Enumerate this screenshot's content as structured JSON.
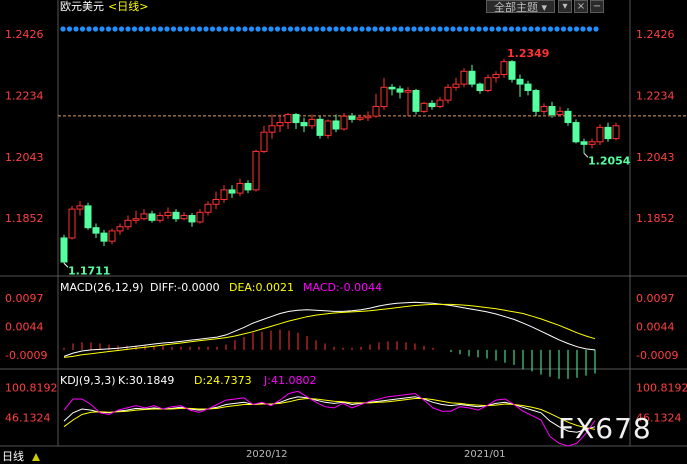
{
  "header": {
    "title_pair": "欧元美元",
    "title_period": "<日线>",
    "theme_button": "全部主题",
    "theme_button_icon": "chevron-down-icon",
    "side_button_icons": [
      "chevron-down-icon",
      "close-icon",
      "minus-icon"
    ]
  },
  "colors": {
    "up": "#ff3232",
    "down": "#54ffa0",
    "price_axis": "#ff4040",
    "macd_label": "#ffffff",
    "dea": "#ffff00",
    "macd": "#ff00ff",
    "j_line": "#ff00ff",
    "dot": "#1e90ff"
  },
  "chart_data": [
    {
      "type": "candlestick",
      "title": "欧元美元<日线>",
      "ylim": [
        1.169,
        1.247
      ],
      "price_ticks": [
        "1.2426",
        "1.2234",
        "1.2043",
        "1.1852"
      ],
      "current_price": 1.2171,
      "annotations": [
        {
          "label": "1.2349",
          "kind": "high"
        },
        {
          "label": "1.2054",
          "kind": "low"
        },
        {
          "label": "1.1711",
          "kind": "low"
        }
      ],
      "candles": [
        [
          1.179,
          1.1715,
          1.18,
          1.1711
        ],
        [
          1.179,
          1.188,
          1.189,
          1.1785
        ],
        [
          1.188,
          1.189,
          1.1905,
          1.186
        ],
        [
          1.189,
          1.1822,
          1.19,
          1.1815
        ],
        [
          1.1822,
          1.1805,
          1.1835,
          1.179
        ],
        [
          1.1805,
          1.178,
          1.1815,
          1.1765
        ],
        [
          1.178,
          1.1812,
          1.182,
          1.177
        ],
        [
          1.1812,
          1.1825,
          1.1835,
          1.18
        ],
        [
          1.1825,
          1.1845,
          1.186,
          1.1815
        ],
        [
          1.1845,
          1.185,
          1.1875,
          1.1835
        ],
        [
          1.185,
          1.1865,
          1.188,
          1.1845
        ],
        [
          1.1865,
          1.1845,
          1.1875,
          1.1838
        ],
        [
          1.1845,
          1.186,
          1.187,
          1.1838
        ],
        [
          1.186,
          1.187,
          1.1885,
          1.185
        ],
        [
          1.187,
          1.185,
          1.188,
          1.184
        ],
        [
          1.185,
          1.186,
          1.187,
          1.1845
        ],
        [
          1.186,
          1.184,
          1.1868,
          1.1825
        ],
        [
          1.184,
          1.187,
          1.188,
          1.1835
        ],
        [
          1.187,
          1.1895,
          1.1905,
          1.186
        ],
        [
          1.1895,
          1.191,
          1.1935,
          1.188
        ],
        [
          1.191,
          1.194,
          1.1955,
          1.19
        ],
        [
          1.194,
          1.193,
          1.1955,
          1.1915
        ],
        [
          1.193,
          1.196,
          1.1975,
          1.192
        ],
        [
          1.196,
          1.194,
          1.197,
          1.193
        ],
        [
          1.194,
          1.206,
          1.2065,
          1.1935
        ],
        [
          1.206,
          1.212,
          1.214,
          1.2055
        ],
        [
          1.212,
          1.214,
          1.2175,
          1.21
        ],
        [
          1.214,
          1.215,
          1.2175,
          1.212
        ],
        [
          1.215,
          1.2175,
          1.218,
          1.213
        ],
        [
          1.2175,
          1.215,
          1.218,
          1.213
        ],
        [
          1.215,
          1.214,
          1.2165,
          1.212
        ],
        [
          1.214,
          1.216,
          1.2175,
          1.213
        ],
        [
          1.216,
          1.211,
          1.217,
          1.21
        ],
        [
          1.211,
          1.2155,
          1.216,
          1.21
        ],
        [
          1.2155,
          1.213,
          1.2175,
          1.212
        ],
        [
          1.213,
          1.217,
          1.218,
          1.2125
        ],
        [
          1.217,
          1.216,
          1.218,
          1.215
        ],
        [
          1.216,
          1.2165,
          1.2175,
          1.2155
        ],
        [
          1.2165,
          1.217,
          1.2185,
          1.2155
        ],
        [
          1.217,
          1.22,
          1.224,
          1.2165
        ],
        [
          1.22,
          1.226,
          1.229,
          1.219
        ],
        [
          1.226,
          1.2255,
          1.227,
          1.2235
        ],
        [
          1.2255,
          1.2245,
          1.2265,
          1.2225
        ],
        [
          1.2245,
          1.225,
          1.226,
          1.217
        ],
        [
          1.225,
          1.2185,
          1.2255,
          1.2175
        ],
        [
          1.2185,
          1.221,
          1.2215,
          1.218
        ],
        [
          1.221,
          1.22,
          1.222,
          1.219
        ],
        [
          1.22,
          1.222,
          1.223,
          1.2195
        ],
        [
          1.222,
          1.226,
          1.227,
          1.221
        ],
        [
          1.226,
          1.227,
          1.229,
          1.225
        ],
        [
          1.227,
          1.231,
          1.232,
          1.226
        ],
        [
          1.231,
          1.227,
          1.233,
          1.226
        ],
        [
          1.227,
          1.225,
          1.2275,
          1.224
        ],
        [
          1.225,
          1.229,
          1.23,
          1.2245
        ],
        [
          1.229,
          1.23,
          1.231,
          1.2275
        ],
        [
          1.23,
          1.234,
          1.2349,
          1.229
        ],
        [
          1.234,
          1.2285,
          1.2345,
          1.2275
        ],
        [
          1.2285,
          1.227,
          1.23,
          1.223
        ],
        [
          1.227,
          1.225,
          1.228,
          1.2235
        ],
        [
          1.225,
          1.2185,
          1.2255,
          1.217
        ],
        [
          1.2185,
          1.22,
          1.221,
          1.2175
        ],
        [
          1.22,
          1.2175,
          1.2215,
          1.2165
        ],
        [
          1.2175,
          1.2185,
          1.22,
          1.217
        ],
        [
          1.2185,
          1.215,
          1.2195,
          1.214
        ],
        [
          1.215,
          1.209,
          1.216,
          1.2085
        ],
        [
          1.209,
          1.2082,
          1.21,
          1.2054
        ],
        [
          1.2082,
          1.209,
          1.21,
          1.207
        ],
        [
          1.209,
          1.2135,
          1.2145,
          1.208
        ],
        [
          1.2135,
          1.21,
          1.215,
          1.209
        ],
        [
          1.21,
          1.214,
          1.215,
          1.2095
        ]
      ]
    },
    {
      "type": "line",
      "title": "MACD(26,12,9)",
      "legend": [
        "DIFF:-0.0000",
        "DEA:0.0021",
        "MACD:-0.0044"
      ],
      "ylim": [
        -0.003,
        0.011
      ],
      "y_ticks": [
        "0.0097",
        "0.0044",
        "-0.0009"
      ],
      "series": [
        {
          "name": "DIFF",
          "values": [
            -0.0012,
            -0.0006,
            -0.0002,
            0.0,
            0.0001,
            0.0002,
            0.0003,
            0.0005,
            0.0007,
            0.0009,
            0.0011,
            0.0013,
            0.0014,
            0.0016,
            0.0018,
            0.002,
            0.0022,
            0.0024,
            0.0028,
            0.0035,
            0.0042,
            0.005,
            0.0056,
            0.0062,
            0.0068,
            0.0072,
            0.0074,
            0.0075,
            0.0074,
            0.0073,
            0.0072,
            0.0072,
            0.0073,
            0.0075,
            0.0078,
            0.0082,
            0.0085,
            0.0087,
            0.0088,
            0.0089,
            0.0088,
            0.0087,
            0.0085,
            0.0083,
            0.008,
            0.0077,
            0.0074,
            0.0071,
            0.0067,
            0.0062,
            0.0057,
            0.005,
            0.0043,
            0.0035,
            0.0027,
            0.0019,
            0.0012,
            0.0006,
            0.0002,
            0.0
          ]
        },
        {
          "name": "DEA",
          "values": [
            -0.0014,
            -0.0012,
            -0.0009,
            -0.0007,
            -0.0005,
            -0.0003,
            -0.0001,
            0.0001,
            0.0003,
            0.0005,
            0.0007,
            0.0009,
            0.0011,
            0.0013,
            0.0015,
            0.0017,
            0.0019,
            0.0021,
            0.0023,
            0.0026,
            0.003,
            0.0034,
            0.0039,
            0.0044,
            0.0049,
            0.0054,
            0.0058,
            0.0062,
            0.0065,
            0.0067,
            0.0069,
            0.007,
            0.0071,
            0.0072,
            0.0073,
            0.0075,
            0.0077,
            0.0079,
            0.0081,
            0.0083,
            0.0084,
            0.0085,
            0.0085,
            0.0085,
            0.0084,
            0.0083,
            0.0081,
            0.0079,
            0.0077,
            0.0074,
            0.0071,
            0.0068,
            0.0063,
            0.0058,
            0.0052,
            0.0046,
            0.0039,
            0.0032,
            0.0026,
            0.0021
          ]
        },
        {
          "name": "MACD",
          "values": [
            0.0004,
            0.0012,
            0.0014,
            0.0014,
            0.0012,
            0.001,
            0.0008,
            0.0008,
            0.0008,
            0.0008,
            0.0008,
            0.0008,
            0.0006,
            0.0006,
            0.0006,
            0.0006,
            0.0006,
            0.0006,
            0.001,
            0.0018,
            0.0024,
            0.0032,
            0.0034,
            0.0036,
            0.0038,
            0.0036,
            0.0032,
            0.0026,
            0.0018,
            0.0012,
            0.0006,
            0.0004,
            0.0004,
            0.0006,
            0.001,
            0.0014,
            0.0016,
            0.0016,
            0.0014,
            0.0012,
            0.0008,
            0.0004,
            0.0,
            -0.0004,
            -0.0008,
            -0.0012,
            -0.0014,
            -0.0016,
            -0.002,
            -0.0024,
            -0.0028,
            -0.0036,
            -0.004,
            -0.0046,
            -0.005,
            -0.0054,
            -0.0054,
            -0.0052,
            -0.0048,
            -0.0044
          ]
        }
      ]
    },
    {
      "type": "line",
      "title": "KDJ(9,3,3)",
      "legend": [
        "K:30.1849",
        "D:24.7373",
        "J:41.0802"
      ],
      "ylim": [
        -5,
        118
      ],
      "y_ticks": [
        "100.8192",
        "46.1324"
      ],
      "series": [
        {
          "name": "K",
          "values": [
            40,
            55,
            62,
            60,
            56,
            55,
            58,
            60,
            63,
            62,
            64,
            62,
            63,
            65,
            62,
            60,
            62,
            65,
            70,
            72,
            74,
            70,
            72,
            70,
            74,
            80,
            84,
            82,
            78,
            74,
            72,
            74,
            70,
            72,
            74,
            76,
            78,
            80,
            82,
            84,
            80,
            74,
            70,
            68,
            70,
            68,
            66,
            68,
            72,
            74,
            70,
            65,
            60,
            55,
            40,
            30,
            22,
            20,
            25,
            30
          ]
        },
        {
          "name": "D",
          "values": [
            30,
            42,
            52,
            56,
            57,
            56,
            57,
            58,
            60,
            61,
            62,
            62,
            62,
            63,
            63,
            62,
            62,
            63,
            66,
            68,
            70,
            70,
            71,
            71,
            72,
            75,
            79,
            81,
            80,
            78,
            76,
            75,
            73,
            73,
            73,
            74,
            75,
            77,
            79,
            81,
            81,
            79,
            76,
            73,
            72,
            70,
            69,
            68,
            69,
            71,
            70,
            68,
            65,
            61,
            54,
            46,
            38,
            32,
            28,
            25
          ]
        },
        {
          "name": "J",
          "values": [
            60,
            80,
            80,
            70,
            55,
            52,
            60,
            64,
            68,
            64,
            68,
            62,
            66,
            68,
            60,
            56,
            62,
            70,
            78,
            80,
            82,
            70,
            74,
            68,
            78,
            90,
            94,
            84,
            74,
            66,
            64,
            72,
            64,
            70,
            76,
            80,
            84,
            86,
            88,
            90,
            78,
            64,
            58,
            58,
            66,
            64,
            60,
            68,
            78,
            80,
            70,
            58,
            50,
            42,
            12,
            0,
            -5,
            0,
            18,
            41
          ]
        }
      ]
    }
  ],
  "time_axis": {
    "labels": [
      "2020/12",
      "2021/01"
    ]
  },
  "footer": {
    "period_label": "日线",
    "arrow_icon": "triangle-up-icon"
  },
  "watermark": "FX678"
}
